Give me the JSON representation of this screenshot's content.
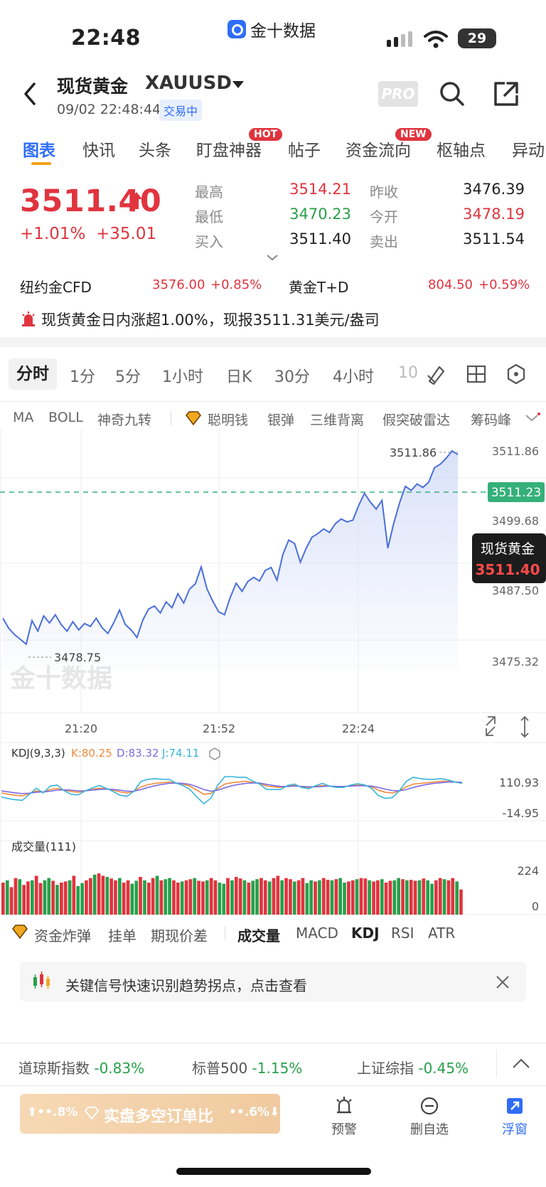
{
  "status_bar": {
    "time": "22:48",
    "app_name": "金十数据",
    "battery": "29"
  },
  "header": {
    "title": "现货黄金",
    "code": "XAUUSD",
    "datetime": "09/02 22:48:44",
    "trading_status": "交易中",
    "pro_label": "PRO"
  },
  "tabs": [
    {
      "label": "图表"
    },
    {
      "label": "快讯"
    },
    {
      "label": "头条"
    },
    {
      "label": "盯盘神器",
      "badge": "HOT"
    },
    {
      "label": "帖子"
    },
    {
      "label": "资金流向",
      "badge": "NEW"
    },
    {
      "label": "枢轴点"
    },
    {
      "label": "异动"
    }
  ],
  "quote": {
    "price": "3511.40",
    "change_pct": "+1.01%",
    "change_abs": "+35.01",
    "high_label": "最高",
    "high": "3514.21",
    "low_label": "最低",
    "low": "3470.23",
    "bid_label": "买入",
    "bid": "3511.40",
    "prev_close_label": "昨收",
    "prev_close": "3476.39",
    "open_label": "今开",
    "open": "3478.19",
    "ask_label": "卖出",
    "ask": "3511.54"
  },
  "related": [
    {
      "name": "纽约金CFD",
      "price": "3576.00",
      "pct": "+0.85%"
    },
    {
      "name": "黄金T+D",
      "price": "804.50",
      "pct": "+0.59%"
    }
  ],
  "alert_text": "现货黄金日内涨超1.00%，现报3511.31美元/盎司",
  "chart_tabs": [
    "分时",
    "1分",
    "5分",
    "1小时",
    "日K",
    "30分",
    "4小时",
    "10"
  ],
  "indicators_row": [
    "MA",
    "BOLL",
    "神奇九转",
    "聪明钱",
    "银弹",
    "三维背离",
    "假突破雷达",
    "筹码峰"
  ],
  "chart": {
    "y_ticks": [
      "3511.86",
      "3499.68",
      "3487.50",
      "3475.32"
    ],
    "x_ticks": [
      "21:20",
      "21:52",
      "22:24"
    ],
    "high_marker": "3511.86",
    "low_marker": "3478.75",
    "current_tag": "3511.23",
    "tooltip_name": "现货黄金",
    "tooltip_price": "3511.40",
    "watermark": "金十数据",
    "kdj_label": "KDJ(9,3,3)",
    "kdj_k": "K:80.25",
    "kdj_d": "D:83.32",
    "kdj_j": "J:74.11",
    "kdj_top": "110.93",
    "kdj_bottom": "-14.95",
    "vol_label": "成交量(111)",
    "vol_top": "224",
    "vol_bottom": "0",
    "colors": {
      "line": "#4a6fdc",
      "up": "#e0343e",
      "down": "#27a04a",
      "k": "#f08a3c",
      "d": "#7b6ae0",
      "j": "#39b3d8"
    }
  },
  "chart_data": {
    "type": "line",
    "y_range": [
      3475.32,
      3511.86
    ],
    "price_series": [
      3483.2,
      3481.5,
      3480.4,
      3479.6,
      3478.75,
      3482.8,
      3481.0,
      3483.6,
      3482.4,
      3483.8,
      3482.1,
      3481.0,
      3482.6,
      3481.2,
      3482.3,
      3481.8,
      3483.2,
      3481.6,
      3480.6,
      3482.4,
      3484.6,
      3482.1,
      3481.2,
      3479.9,
      3482.9,
      3484.8,
      3485.3,
      3484.1,
      3486.0,
      3485.0,
      3487.4,
      3485.8,
      3488.2,
      3489.1,
      3492.0,
      3488.2,
      3486.1,
      3484.3,
      3483.8,
      3486.8,
      3489.2,
      3487.8,
      3489.5,
      3490.2,
      3489.6,
      3491.4,
      3491.9,
      3489.7,
      3494.1,
      3496.6,
      3496.0,
      3492.8,
      3495.2,
      3497.1,
      3497.7,
      3498.5,
      3497.9,
      3499.4,
      3500.2,
      3499.7,
      3500.0,
      3502.5,
      3504.6,
      3503.1,
      3501.9,
      3503.4,
      3495.2,
      3499.4,
      3502.9,
      3505.8,
      3505.1,
      3506.2,
      3505.6,
      3506.5,
      3509.0,
      3509.6,
      3510.6,
      3511.86,
      3511.23
    ],
    "kdj_k": [
      42,
      38,
      35,
      33,
      40,
      48,
      44,
      52,
      55,
      50,
      46,
      44,
      48,
      52,
      56,
      54,
      50,
      45,
      42,
      47,
      60,
      66,
      70,
      72,
      74,
      71,
      68,
      62,
      50,
      38,
      40,
      55,
      68,
      72,
      74,
      76,
      73,
      70,
      62,
      60,
      58,
      62,
      64,
      60,
      58,
      61,
      64,
      62,
      60,
      60,
      63,
      65,
      64,
      60,
      50,
      44,
      42,
      48,
      60,
      68,
      70,
      72,
      74,
      76,
      76,
      74,
      72
    ],
    "kdj_d": [
      48,
      45,
      42,
      40,
      41,
      44,
      45,
      47,
      50,
      51,
      50,
      48,
      48,
      50,
      52,
      53,
      52,
      50,
      47,
      47,
      52,
      58,
      63,
      67,
      70,
      71,
      70,
      67,
      60,
      52,
      47,
      50,
      57,
      63,
      67,
      70,
      71,
      71,
      67,
      64,
      61,
      61,
      62,
      61,
      60,
      60,
      61,
      62,
      61,
      61,
      62,
      63,
      63,
      62,
      58,
      53,
      49,
      48,
      52,
      58,
      63,
      67,
      70,
      72,
      74,
      74,
      73
    ],
    "kdj_j": [
      30,
      25,
      22,
      20,
      38,
      56,
      42,
      62,
      65,
      48,
      38,
      36,
      48,
      56,
      64,
      56,
      46,
      35,
      32,
      47,
      76,
      82,
      84,
      82,
      82,
      71,
      64,
      52,
      30,
      10,
      26,
      65,
      90,
      90,
      88,
      88,
      77,
      68,
      52,
      52,
      52,
      64,
      68,
      58,
      54,
      63,
      70,
      62,
      58,
      58,
      65,
      69,
      66,
      56,
      34,
      26,
      28,
      48,
      76,
      88,
      84,
      82,
      82,
      84,
      80,
      74,
      70
    ],
    "volume": [
      140,
      150,
      120,
      160,
      155,
      130,
      145,
      150,
      170,
      138,
      150,
      160,
      148,
      130,
      140,
      145,
      150,
      170,
      125,
      138,
      150,
      160,
      175,
      180,
      170,
      165,
      158,
      150,
      160,
      140,
      150,
      135,
      148,
      165,
      150,
      140,
      160,
      170,
      150,
      155,
      160,
      150,
      140,
      145,
      150,
      155,
      160,
      148,
      145,
      150,
      160,
      150,
      140,
      135,
      160,
      150,
      165,
      158,
      150,
      140,
      148,
      155,
      160,
      150,
      145,
      160,
      170,
      150,
      160,
      155,
      145,
      150,
      160,
      138,
      150,
      145,
      150,
      160,
      152,
      150,
      155,
      160,
      140,
      145,
      150,
      155,
      160,
      158,
      150,
      145,
      150,
      155,
      140,
      148,
      150,
      160,
      155,
      150,
      152,
      148,
      150,
      158,
      150,
      135,
      150,
      160,
      155,
      150,
      160,
      145,
      110
    ],
    "xlabel": "",
    "ylabel": ""
  },
  "feature_row": [
    "资金炸弹",
    "挂单",
    "期现价差",
    "成交量",
    "MACD",
    "KDJ",
    "RSI",
    "ATR"
  ],
  "signal_card_text": "关键信号快速识别趋势拐点，点击查看",
  "indices": [
    {
      "name": "道琼斯指数",
      "pct": "-0.83%"
    },
    {
      "name": "标普500",
      "pct": "-1.15%"
    },
    {
      "name": "上证综指",
      "pct": "-0.45%"
    }
  ],
  "ratio_bar": {
    "label": "实盘多空订单比",
    "left": "••.8%",
    "right": "••.6%"
  },
  "bottom_nav": [
    "预警",
    "删自选",
    "浮窗"
  ]
}
